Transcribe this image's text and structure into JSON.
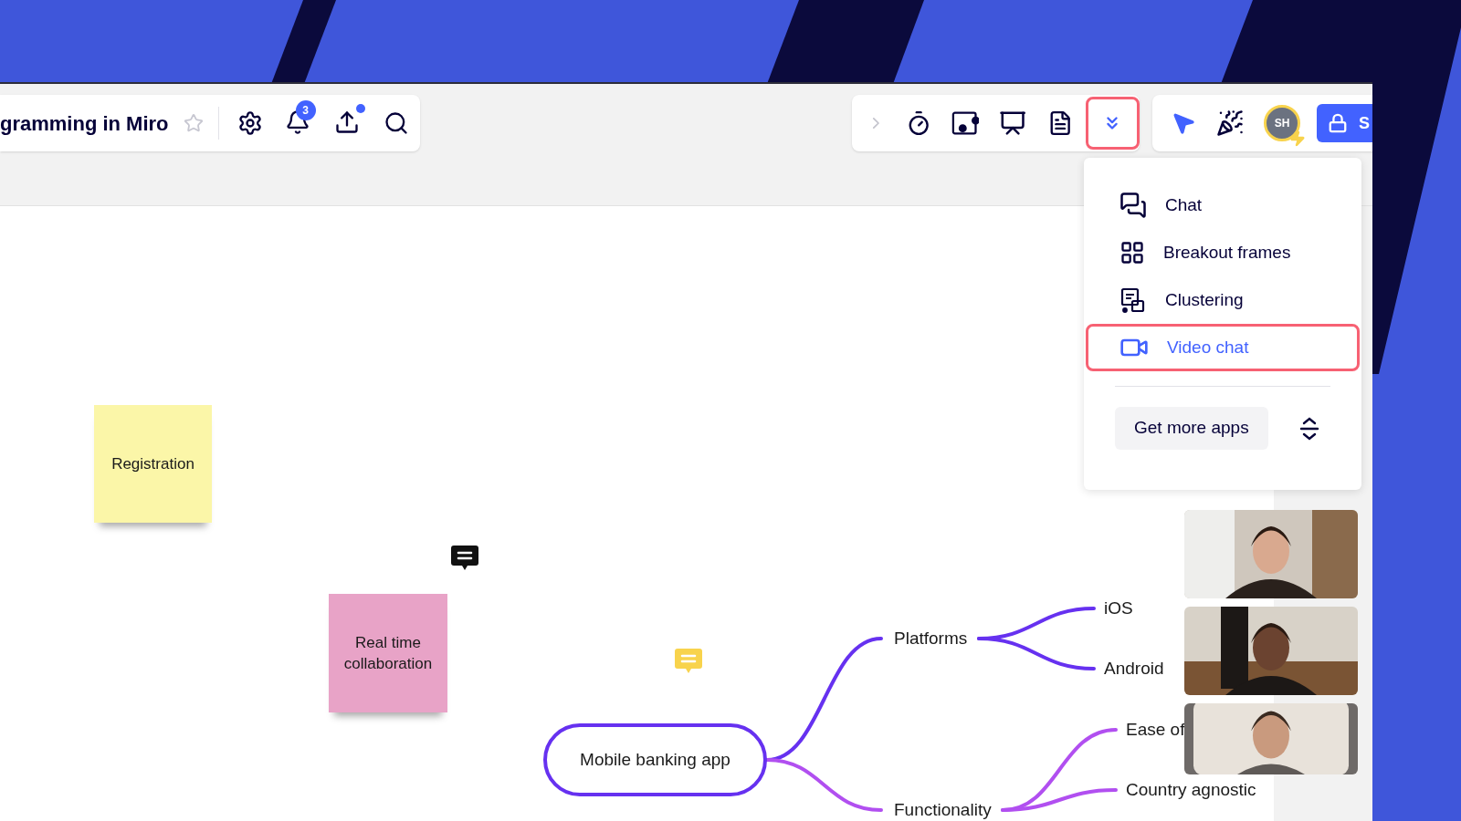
{
  "header": {
    "board_title": "gramming in Miro",
    "starred": false,
    "notification_count": "3",
    "upload_has_update": true
  },
  "toolbar": {
    "more_expanded": true,
    "avatar_initials": "SH",
    "share_label": "S"
  },
  "apps_menu": {
    "items": [
      {
        "label": "Chat",
        "kind": "chat",
        "selected": false
      },
      {
        "label": "Breakout frames",
        "kind": "frames",
        "selected": false
      },
      {
        "label": "Clustering",
        "kind": "clustering",
        "selected": false
      },
      {
        "label": "Video chat",
        "kind": "video",
        "selected": true
      }
    ],
    "get_more_apps": "Get more apps"
  },
  "canvas": {
    "stickies": [
      {
        "text": "Registration",
        "color": "#fbf6a8"
      },
      {
        "text": "Real time collaboration",
        "color": "#e8a3c7"
      }
    ],
    "comments": [
      {
        "color": "#111111"
      },
      {
        "color": "#f8d34c"
      }
    ],
    "mind_map": {
      "root": "Mobile banking app",
      "branches": [
        {
          "label": "Platforms",
          "children": [
            {
              "label": "iOS"
            },
            {
              "label": "Android"
            }
          ]
        },
        {
          "label": "Functionality",
          "children": [
            {
              "label": "Ease of"
            },
            {
              "label": "Country agnostic"
            }
          ]
        }
      ]
    }
  }
}
